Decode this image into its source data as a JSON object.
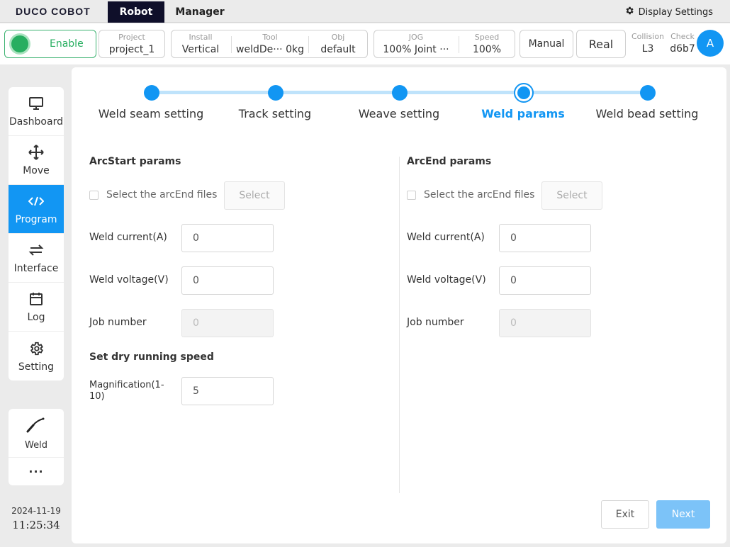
{
  "app": {
    "logo": "DUCO COBOT",
    "tabs": [
      "Robot",
      "Manager"
    ],
    "display_settings": "Display Settings"
  },
  "status": {
    "enable": "Enable",
    "project": {
      "k": "Project",
      "v": "project_1"
    },
    "install": {
      "k": "Install",
      "v": "Vertical"
    },
    "tool": {
      "k": "Tool",
      "v": "weldDe···  0kg"
    },
    "obj": {
      "k": "Obj",
      "v": "default"
    },
    "jog": {
      "k": "JOG",
      "v": "100%  Joint ···"
    },
    "speed": {
      "k": "Speed",
      "v": "100%"
    },
    "mode": "Manual",
    "env": "Real",
    "collision": {
      "k": "Collision",
      "v": "L3"
    },
    "check": {
      "k": "Check",
      "v": "d6b7"
    },
    "avatar": "A"
  },
  "nav": {
    "items": [
      {
        "label": "Dashboard",
        "icon": "monitor-icon"
      },
      {
        "label": "Move",
        "icon": "move-arrows-icon"
      },
      {
        "label": "Program",
        "icon": "code-icon"
      },
      {
        "label": "Interface",
        "icon": "swap-icon"
      },
      {
        "label": "Log",
        "icon": "calendar-icon"
      },
      {
        "label": "Setting",
        "icon": "gear-icon"
      }
    ],
    "active": "Program",
    "weld": "Weld",
    "more": "···",
    "date": "2024-11-19",
    "time": "11:25:34"
  },
  "stepper": {
    "steps": [
      "Weld seam setting",
      "Track setting",
      "Weave setting",
      "Weld params",
      "Weld bead setting"
    ],
    "current": "Weld params"
  },
  "arcstart": {
    "title": "ArcStart params",
    "checkbox": "Select the arcEnd files",
    "select": "Select",
    "current_label": "Weld current(A)",
    "current_value": "0",
    "voltage_label": "Weld voltage(V)",
    "voltage_value": "0",
    "job_label": "Job number",
    "job_value": "0"
  },
  "dry": {
    "title": "Set dry running speed",
    "mag_label": "Magnification(1-10)",
    "mag_value": "5"
  },
  "arcend": {
    "title": "ArcEnd params",
    "checkbox": "Select the arcEnd files",
    "select": "Select",
    "current_label": "Weld current(A)",
    "current_value": "0",
    "voltage_label": "Weld voltage(V)",
    "voltage_value": "0",
    "job_label": "Job number",
    "job_value": "0"
  },
  "footer": {
    "exit": "Exit",
    "next": "Next"
  },
  "colors": {
    "accent": "#1296f3",
    "enable": "#27ae60",
    "nav_dark": "#0f0f2a"
  }
}
